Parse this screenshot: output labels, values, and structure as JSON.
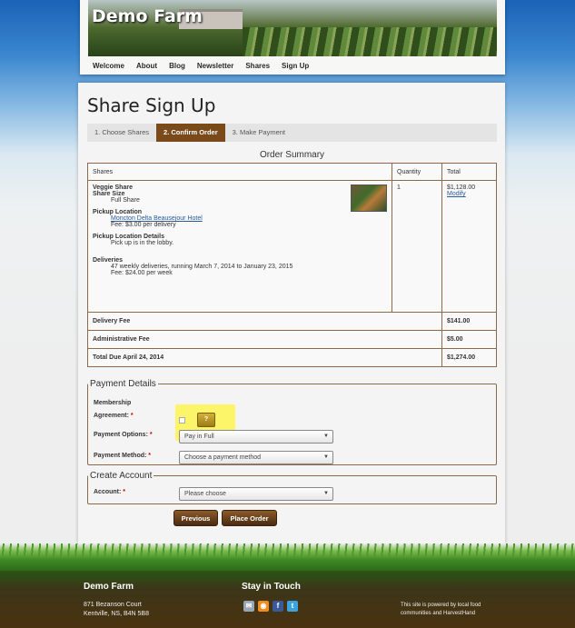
{
  "site": {
    "title": "Demo Farm",
    "nav": [
      "Welcome",
      "About",
      "Blog",
      "Newsletter",
      "Shares",
      "Sign Up"
    ]
  },
  "page": {
    "title": "Share Sign Up",
    "steps": [
      "1. Choose Shares",
      "2. Confirm Order",
      "3. Make Payment"
    ],
    "active_step": 1,
    "summary_title": "Order Summary"
  },
  "order": {
    "headers": {
      "shares": "Shares",
      "quantity": "Quantity",
      "total": "Total"
    },
    "item": {
      "name": "Veggie Share",
      "size_label": "Share Size",
      "size_value": "Full Share",
      "pickup_label": "Pickup Location",
      "pickup_value": "Moncton Delta Beausejour Hotel",
      "pickup_fee": "Fee: $3.00 per delivery",
      "details_label": "Pickup Location Details",
      "details_value": "Pick up is in the lobby.",
      "deliveries_label": "Deliveries",
      "deliveries_value": "47 weekly deliveries, running March 7, 2014 to January 23, 2015",
      "deliveries_fee": "Fee: $24.00 per week",
      "quantity": "1",
      "total": "$1,128.00",
      "modify": "Modify"
    },
    "delivery_fee_label": "Delivery Fee",
    "delivery_fee": "$141.00",
    "admin_fee_label": "Administrative Fee",
    "admin_fee": "$5.00",
    "total_due_label": "Total Due April 24, 2014",
    "total_due": "$1,274.00"
  },
  "payment": {
    "legend": "Payment Details",
    "membership_label_1": "Membership",
    "membership_label_2": "Agreement:",
    "required": "*",
    "help": "?",
    "options_label": "Payment Options:",
    "options_value": "Pay in Full",
    "method_label": "Payment Method:",
    "method_value": "Choose a payment method"
  },
  "account": {
    "legend": "Create Account",
    "label": "Account:",
    "value": "Please choose"
  },
  "buttons": {
    "previous": "Previous",
    "place_order": "Place Order"
  },
  "footer": {
    "farm_title": "Demo Farm",
    "address_1": "871 Bezanson Court",
    "address_2": "Kentville, NS, B4N 5B8",
    "stay_title": "Stay in Touch",
    "powered_1": "This site is powered by local food",
    "powered_2": "communities and HarvestHand"
  },
  "colors": {
    "accent": "#7a4a1b",
    "highlight": "#fcf469",
    "link": "#2a5a9a"
  }
}
